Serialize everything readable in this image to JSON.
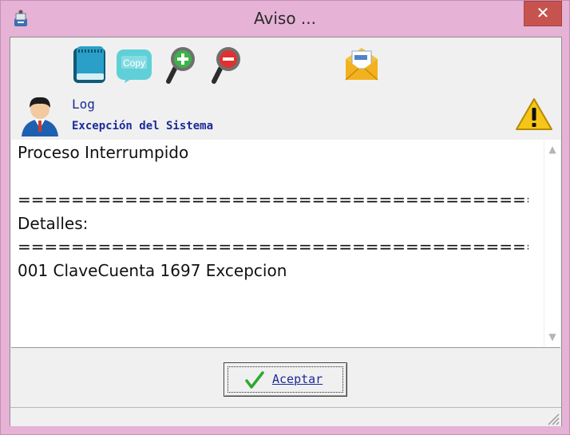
{
  "window": {
    "title": "Aviso ...",
    "close_glyph": "✕"
  },
  "toolbar": {
    "buttons": [
      {
        "name": "notebook-icon"
      },
      {
        "name": "copy-icon",
        "label": "Copy"
      },
      {
        "name": "zoom-in-icon"
      },
      {
        "name": "zoom-out-icon"
      },
      {
        "name": "email-icon"
      }
    ]
  },
  "header": {
    "log_label": "Log",
    "subtitle": "Excepción del Sistema",
    "user_icon": "user-avatar-icon",
    "warning_icon": "warning-icon"
  },
  "message": {
    "text": "Proceso Interrumpido\n\n=============================================\nDetalles:\n=============================================\n001 ClaveCuenta 1697 Excepcion"
  },
  "ok_button": {
    "label": "Aceptar",
    "icon": "checkmark-icon"
  },
  "colors": {
    "frame": "#e6b2d6",
    "close": "#c7534f",
    "label_blue": "#1b2a9a"
  }
}
